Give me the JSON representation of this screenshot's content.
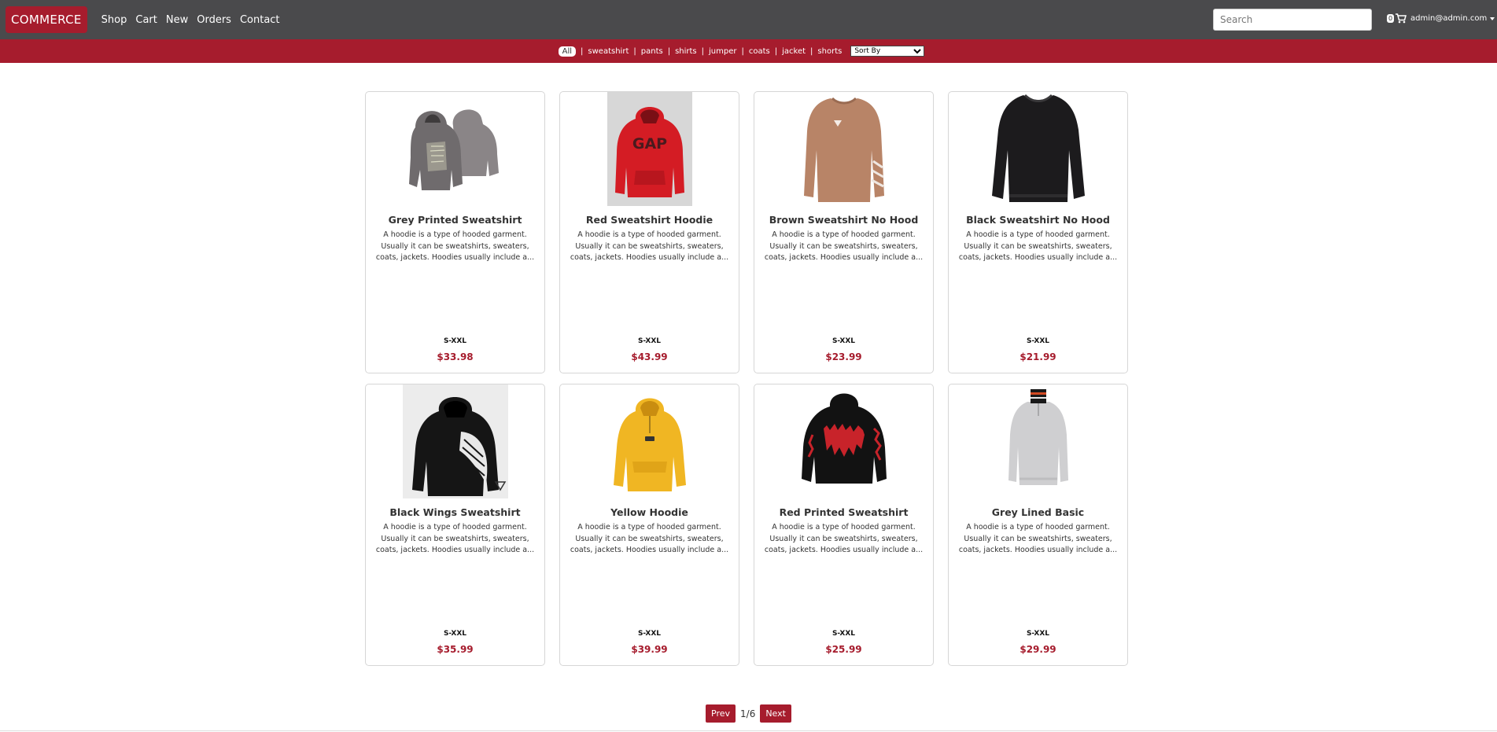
{
  "nav": {
    "brand": "COMMERCE",
    "links": [
      "Shop",
      "Cart",
      "New",
      "Orders",
      "Contact"
    ],
    "search_placeholder": "Search",
    "cart_count": "0",
    "user": "admin@admin.com"
  },
  "filters": {
    "all": "All",
    "items": [
      "sweatshirt",
      "pants",
      "shirts",
      "jumper",
      "coats",
      "jacket",
      "shorts"
    ],
    "sort_label": "Sort By"
  },
  "products": [
    {
      "name": "Grey Printed Sweatshirt",
      "desc": "A hoodie is a type of hooded garment. Usually it can be sweatshirts, sweaters, coats, jackets. Hoodies usually include a...",
      "size": "S-XXL",
      "price": "$33.98",
      "icon": "grey-hoodie-pair-image",
      "color": "#7a7677"
    },
    {
      "name": "Red Sweatshirt Hoodie",
      "desc": "A hoodie is a type of hooded garment. Usually it can be sweatshirts, sweaters, coats, jackets. Hoodies usually include a...",
      "size": "S-XXL",
      "price": "$43.99",
      "icon": "red-gap-hoodie-image",
      "color": "#d41c24"
    },
    {
      "name": "Brown Sweatshirt No Hood",
      "desc": "A hoodie is a type of hooded garment. Usually it can be sweatshirts, sweaters, coats, jackets. Hoodies usually include a...",
      "size": "S-XXL",
      "price": "$23.99",
      "icon": "brown-crewneck-image",
      "color": "#b88467"
    },
    {
      "name": "Black Sweatshirt No Hood",
      "desc": "A hoodie is a type of hooded garment. Usually it can be sweatshirts, sweaters, coats, jackets. Hoodies usually include a...",
      "size": "S-XXL",
      "price": "$21.99",
      "icon": "black-crewneck-image",
      "color": "#1c1b1d"
    },
    {
      "name": "Black Wings Sweatshirt",
      "desc": "A hoodie is a type of hooded garment. Usually it can be sweatshirts, sweaters, coats, jackets. Hoodies usually include a...",
      "size": "S-XXL",
      "price": "$35.99",
      "icon": "black-wings-hoodie-image",
      "color": "#151515"
    },
    {
      "name": "Yellow Hoodie",
      "desc": "A hoodie is a type of hooded garment. Usually it can be sweatshirts, sweaters, coats, jackets. Hoodies usually include a...",
      "size": "S-XXL",
      "price": "$39.99",
      "icon": "yellow-hoodie-image",
      "color": "#f0b623"
    },
    {
      "name": "Red Printed Sweatshirt",
      "desc": "A hoodie is a type of hooded garment. Usually it can be sweatshirts, sweaters, coats, jackets. Hoodies usually include a...",
      "size": "S-XXL",
      "price": "$25.99",
      "icon": "black-red-print-hoodie-image",
      "color": "#121212"
    },
    {
      "name": "Grey Lined Basic",
      "desc": "A hoodie is a type of hooded garment. Usually it can be sweatshirts, sweaters, coats, jackets. Hoodies usually include a...",
      "size": "S-XXL",
      "price": "$29.99",
      "icon": "grey-zip-sweater-image",
      "color": "#cfcfd1"
    }
  ],
  "pager": {
    "prev": "Prev",
    "page": "1/6",
    "next": "Next"
  },
  "colors": {
    "nav": "#4a4a4c",
    "accent": "#a61c2d"
  }
}
